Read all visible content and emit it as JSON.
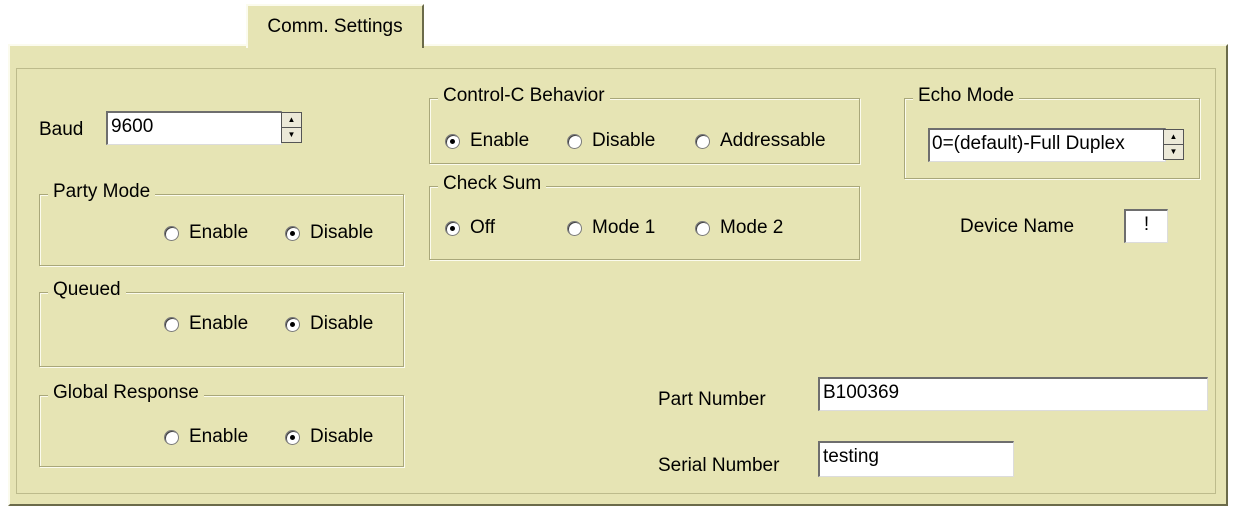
{
  "tab": {
    "label": "Comm. Settings"
  },
  "baud": {
    "label": "Baud",
    "value": "9600"
  },
  "party_mode": {
    "title": "Party Mode",
    "enable": "Enable",
    "disable": "Disable",
    "selected": "Disable"
  },
  "queued": {
    "title": "Queued",
    "enable": "Enable",
    "disable": "Disable",
    "selected": "Disable"
  },
  "global_response": {
    "title": "Global Response",
    "enable": "Enable",
    "disable": "Disable",
    "selected": "Disable"
  },
  "control_c": {
    "title": "Control-C Behavior",
    "enable": "Enable",
    "disable": "Disable",
    "addressable": "Addressable",
    "selected": "Enable"
  },
  "check_sum": {
    "title": "Check Sum",
    "off": "Off",
    "mode1": "Mode 1",
    "mode2": "Mode 2",
    "selected": "Off"
  },
  "echo_mode": {
    "title": "Echo Mode",
    "value": "0=(default)-Full Duplex"
  },
  "device_name": {
    "label": "Device Name",
    "value": "!"
  },
  "part_number": {
    "label": "Part Number",
    "value": "B100369"
  },
  "serial_number": {
    "label": "Serial Number",
    "value": "testing"
  },
  "colors": {
    "panel": "#e6e4b4",
    "group_border": "#a9a77a",
    "field_bg": "#ffffff"
  },
  "icons": {
    "spin_up": "spin-up-arrow-icon",
    "spin_down": "spin-down-arrow-icon"
  }
}
